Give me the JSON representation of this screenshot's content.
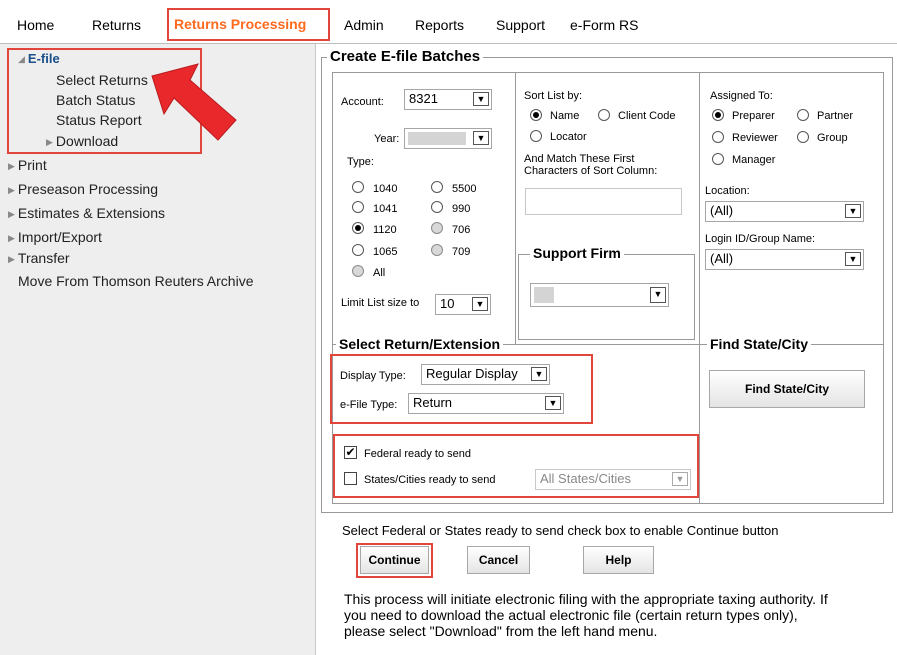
{
  "nav": {
    "items": [
      "Home",
      "Returns",
      "Returns Processing",
      "Admin",
      "Reports",
      "Support",
      "e-Form RS"
    ],
    "active": "Returns Processing",
    "active_color": "#ff6a1f"
  },
  "sidebar": {
    "efile_label": "E-file",
    "efile_children": [
      "Select Returns",
      "Batch Status",
      "Status Report",
      "Download"
    ],
    "items": [
      "Print",
      "Preseason Processing",
      "Estimates & Extensions",
      "Import/Export",
      "Transfer",
      "Move From Thomson Reuters Archive"
    ]
  },
  "main": {
    "title": "Create E-file Batches",
    "account_label": "Account:",
    "account_value": "8321",
    "year_label": "Year:",
    "type_label": "Type:",
    "types": [
      "1040",
      "5500",
      "1041",
      "990",
      "1120",
      "706",
      "1065",
      "709",
      "All"
    ],
    "selected_type": "1120",
    "limit_label": "Limit List size to",
    "limit_value": "10",
    "sort_label": "Sort List by:",
    "sort_options": [
      "Name",
      "Client Code",
      "Locator"
    ],
    "sort_selected": "Name",
    "match_label_1": "And Match These First",
    "match_label_2": "Characters of Sort Column:",
    "support_firm_title": "Support Firm",
    "assigned_label": "Assigned To:",
    "assigned_options": [
      "Preparer",
      "Partner",
      "Reviewer",
      "Group",
      "Manager"
    ],
    "assigned_selected": "Preparer",
    "location_label": "Location:",
    "location_value": "(All)",
    "login_label": "Login ID/Group Name:",
    "login_value": "(All)",
    "select_return_title": "Select Return/Extension",
    "display_type_label": "Display Type:",
    "display_type_value": "Regular Display",
    "efile_type_label": "e-File Type:",
    "efile_type_value": "Return",
    "federal_label": "Federal ready to send",
    "federal_checked": true,
    "states_label": "States/Cities ready to send",
    "states_checked": false,
    "states_select_value": "All States/Cities",
    "find_state_title": "Find State/City",
    "find_state_button": "Find State/City",
    "hint": "Select Federal or States ready to send check box to enable Continue button",
    "buttons": {
      "continue": "Continue",
      "cancel": "Cancel",
      "help": "Help"
    },
    "info_lines": [
      "This process will initiate electronic filing with the appropriate taxing authority. If",
      "you need to download the actual electronic file (certain return types only),",
      "please select \"Download\" from the left hand menu."
    ]
  },
  "colors": {
    "highlight_box": "#e2453c",
    "arrow": "#e8282b",
    "sidebar_bg": "#eeeeee"
  }
}
